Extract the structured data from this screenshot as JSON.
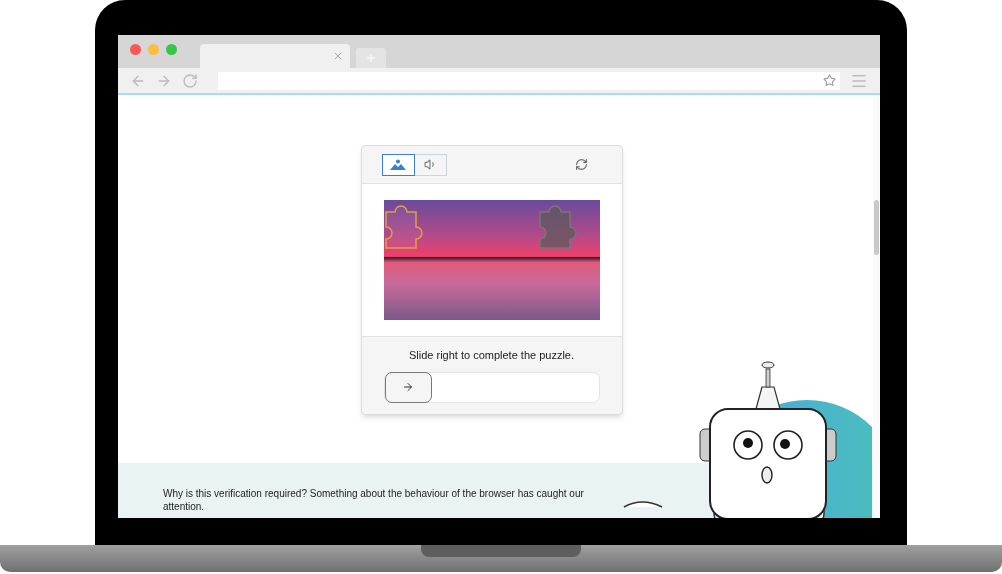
{
  "captcha": {
    "modes": [
      {
        "kind": "image",
        "selected": true
      },
      {
        "kind": "audio",
        "selected": false
      }
    ],
    "instruction": "Slide right to complete the puzzle.",
    "slider": {
      "level": 0
    }
  },
  "info_band": {
    "text": "Why is this verification required? Something about the behaviour of the browser has caught our attention."
  }
}
